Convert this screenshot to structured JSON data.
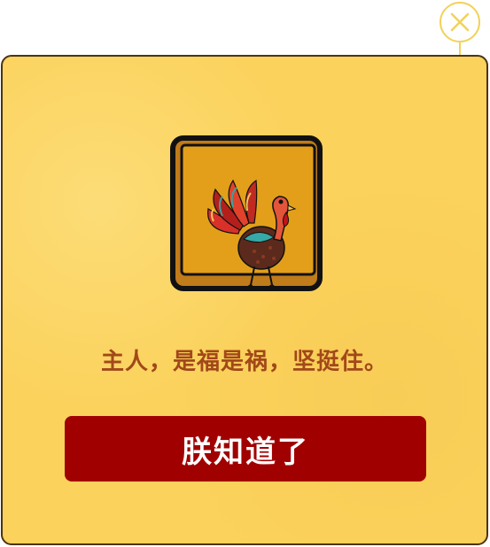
{
  "dialog": {
    "message": "主人，是福是祸，坚挺住。",
    "confirm_label": "朕知道了",
    "close_icon": "close-icon",
    "image_icon": "turkey-icon"
  },
  "colors": {
    "panel": "#fbd25c",
    "panel_border": "#4a3416",
    "message_text": "#a2481a",
    "button_bg": "#a10000",
    "button_text": "#ffffff",
    "close_ring": "#f2d25a"
  }
}
